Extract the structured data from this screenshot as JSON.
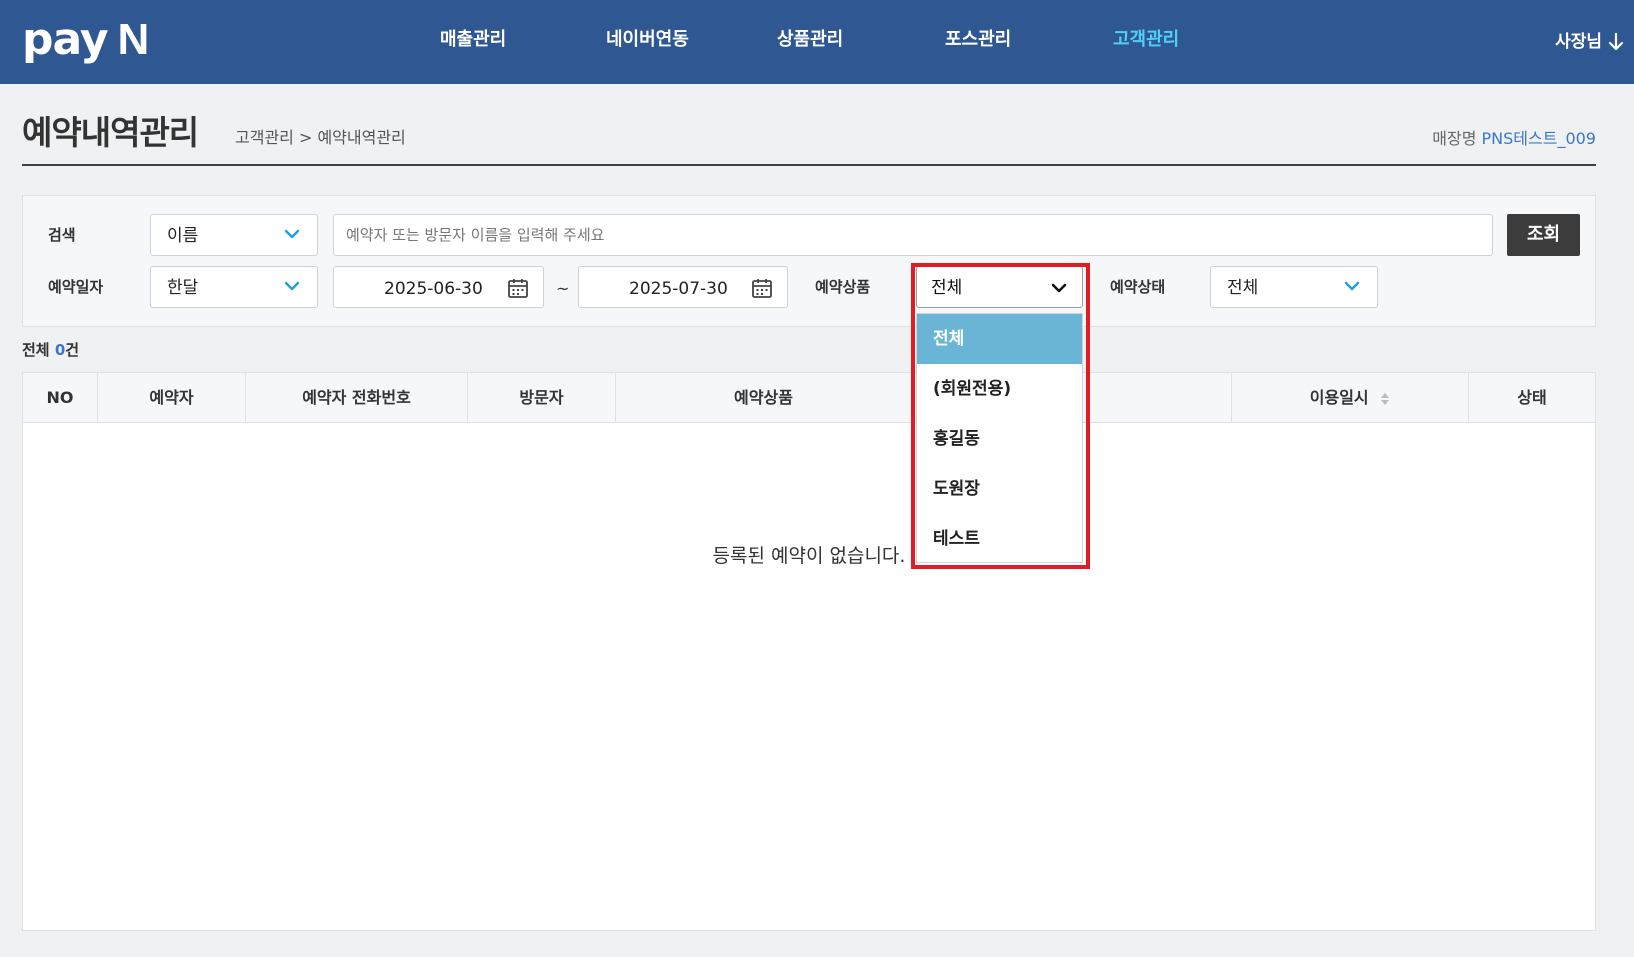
{
  "header": {
    "logo_main": "pay",
    "logo_letter": "N",
    "nav": [
      {
        "label": "매출관리"
      },
      {
        "label": "네이버연동"
      },
      {
        "label": "상품관리"
      },
      {
        "label": "포스관리"
      },
      {
        "label": "고객관리",
        "active": true
      }
    ],
    "user_label": "사장님"
  },
  "page": {
    "title": "예약내역관리",
    "breadcrumb": "고객관리 > 예약내역관리",
    "store_label": "매장명",
    "store_name": "PNS테스트_009"
  },
  "filters": {
    "search_label": "검색",
    "search_type": "이름",
    "search_placeholder": "예약자 또는 방문자 이름을 입력해 주세요",
    "search_button": "조회",
    "date_label": "예약일자",
    "date_range": "한달",
    "date_from": "2025-06-30",
    "date_sep": "~",
    "date_to": "2025-07-30",
    "product_label": "예약상품",
    "product_value": "전체",
    "status_label": "예약상태",
    "status_value": "전체"
  },
  "summary": {
    "total_label": "전체",
    "total_count": "0",
    "total_unit": "건"
  },
  "table": {
    "columns": [
      "NO",
      "예약자",
      "예약자 전화번호",
      "방문자",
      "예약상품",
      "이용일시",
      "상태"
    ],
    "empty_message": "등록된 예약이 없습니다."
  },
  "product_dropdown": {
    "options": [
      "전체",
      "(회원전용)",
      "홍길동",
      "도원장",
      "테스트"
    ],
    "selected_index": 0
  },
  "colors": {
    "nav_bg": "#2f5893",
    "nav_active": "#4fd0f5",
    "accent_blue": "#3a78c8",
    "dropdown_selected": "#6ab4d6",
    "highlight_red": "#e01d25",
    "chevron_blue": "#1ea0d8"
  }
}
